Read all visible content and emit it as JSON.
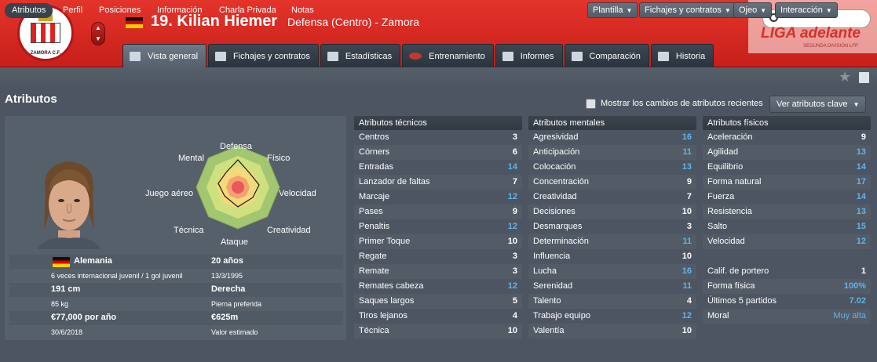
{
  "header": {
    "club_badge_text": "ZAMORA C.F.",
    "number_name": "19. Kilian Hiemer",
    "position_club": "Defensa (Centro) - Zamora",
    "colors": {
      "header_red": "#d42a23",
      "highlight_blue": "#62b3ee"
    }
  },
  "tabs": [
    {
      "label": "Vista general",
      "icon": "overview-icon"
    },
    {
      "label": "Fichajes y contratos",
      "icon": "contract-icon"
    },
    {
      "label": "Estadísticas",
      "icon": "stats-icon"
    },
    {
      "label": "Entrenamiento",
      "icon": "ball-icon"
    },
    {
      "label": "Informes",
      "icon": "report-icon"
    },
    {
      "label": "Comparación",
      "icon": "compare-icon"
    },
    {
      "label": "Historia",
      "icon": "history-icon"
    }
  ],
  "ad": {
    "logo": "LIGA adelante",
    "sub": "SEGUNDA DIVISIÓN  LFP"
  },
  "subnav": {
    "items": [
      "Atributos",
      "Perfil",
      "Posiciones",
      "Información",
      "Charla Privada",
      "Notas"
    ],
    "buttons": [
      "Plantilla",
      "Fichajes y contratos",
      "Ojeo",
      "Interacción"
    ]
  },
  "page": {
    "title": "Atributos",
    "checkbox_label": "Mostrar los cambios de atributos recientes",
    "key_button": "Ver atributos clave"
  },
  "radar": {
    "labels": [
      "Defensa",
      "Físico",
      "Velocidad",
      "Creatividad",
      "Ataque",
      "Técnica",
      "Juego aéreo",
      "Mental"
    ]
  },
  "info": {
    "nationality": "Alemania",
    "age": "20 años",
    "international": "6 veces internacional juvenil / 1 gol juvenil",
    "birth_date": "13/3/1995",
    "height": "191 cm",
    "foot": "Derecha",
    "weight": "85 kg",
    "foot_label": "Pierna preferida",
    "wage": "€77,000 por año",
    "value": "€625m",
    "contract_end": "30/6/2018",
    "value_label": "Valor estimado"
  },
  "technical": {
    "title": "Atributos técnicos",
    "rows": [
      [
        "Centros",
        "3"
      ],
      [
        "Córners",
        "6"
      ],
      [
        "Entradas",
        "14"
      ],
      [
        "Lanzador de faltas",
        "7"
      ],
      [
        "Marcaje",
        "12"
      ],
      [
        "Pases",
        "9"
      ],
      [
        "Penaltis",
        "12"
      ],
      [
        "Primer Toque",
        "10"
      ],
      [
        "Regate",
        "3"
      ],
      [
        "Remate",
        "3"
      ],
      [
        "Remates cabeza",
        "12"
      ],
      [
        "Saques largos",
        "5"
      ],
      [
        "Tiros lejanos",
        "4"
      ],
      [
        "Técnica",
        "10"
      ]
    ]
  },
  "mental": {
    "title": "Atributos mentales",
    "rows": [
      [
        "Agresividad",
        "16"
      ],
      [
        "Anticipación",
        "11"
      ],
      [
        "Colocación",
        "13"
      ],
      [
        "Concentración",
        "9"
      ],
      [
        "Creatividad",
        "7"
      ],
      [
        "Decisiones",
        "10"
      ],
      [
        "Desmarques",
        "3"
      ],
      [
        "Determinación",
        "11"
      ],
      [
        "Influencia",
        "10"
      ],
      [
        "Lucha",
        "16"
      ],
      [
        "Serenidad",
        "11"
      ],
      [
        "Talento",
        "4"
      ],
      [
        "Trabajo equipo",
        "12"
      ],
      [
        "Valentía",
        "10"
      ]
    ]
  },
  "physical": {
    "title": "Atributos físicos",
    "rows": [
      [
        "Aceleración",
        "9"
      ],
      [
        "Agilidad",
        "13"
      ],
      [
        "Equilibrio",
        "14"
      ],
      [
        "Forma natural",
        "17"
      ],
      [
        "Fuerza",
        "14"
      ],
      [
        "Resistencia",
        "13"
      ],
      [
        "Salto",
        "15"
      ],
      [
        "Velocidad",
        "12"
      ]
    ],
    "extra": [
      [
        "Calif. de portero",
        "1"
      ],
      [
        "Forma física",
        "100%"
      ],
      [
        "Últimos 5 partidos",
        "7.02"
      ],
      [
        "Moral",
        "Muy alta"
      ]
    ]
  }
}
